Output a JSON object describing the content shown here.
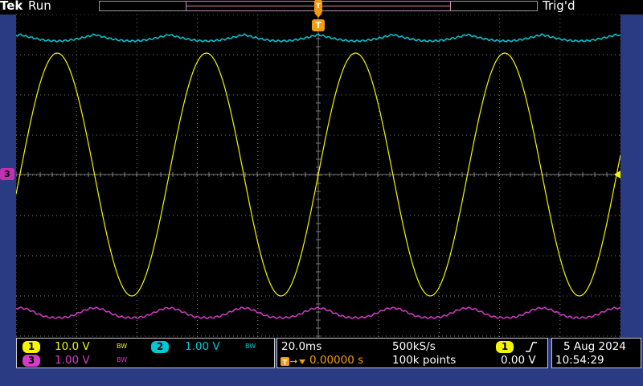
{
  "header": {
    "brand": "Tek",
    "run_state": "Run",
    "trigger_state": "Trig'd"
  },
  "markers": {
    "trigger_position": "T",
    "ch3_ground": "3"
  },
  "channels": [
    {
      "id": "1",
      "scale": "10.0 V",
      "bw": "BW",
      "color": "#f5f500"
    },
    {
      "id": "2",
      "scale": "1.00 V",
      "bw": "BW",
      "color": "#00c8d2"
    },
    {
      "id": "3",
      "scale": "1.00 V",
      "bw": "BW",
      "color": "#d23cc8"
    }
  ],
  "timebase": {
    "scale": "20.0ms",
    "sample_rate": "500kS/s",
    "delay": "0.00000 s",
    "record_length": "100k points"
  },
  "trigger": {
    "source": "1",
    "slope_icon": "rising-edge-icon",
    "level": "0.00 V"
  },
  "datetime": {
    "date": "5 Aug 2024",
    "time": "10:54:29"
  },
  "colors": {
    "grid": "#7a7a7a",
    "trigger": "#f39a0e"
  }
}
